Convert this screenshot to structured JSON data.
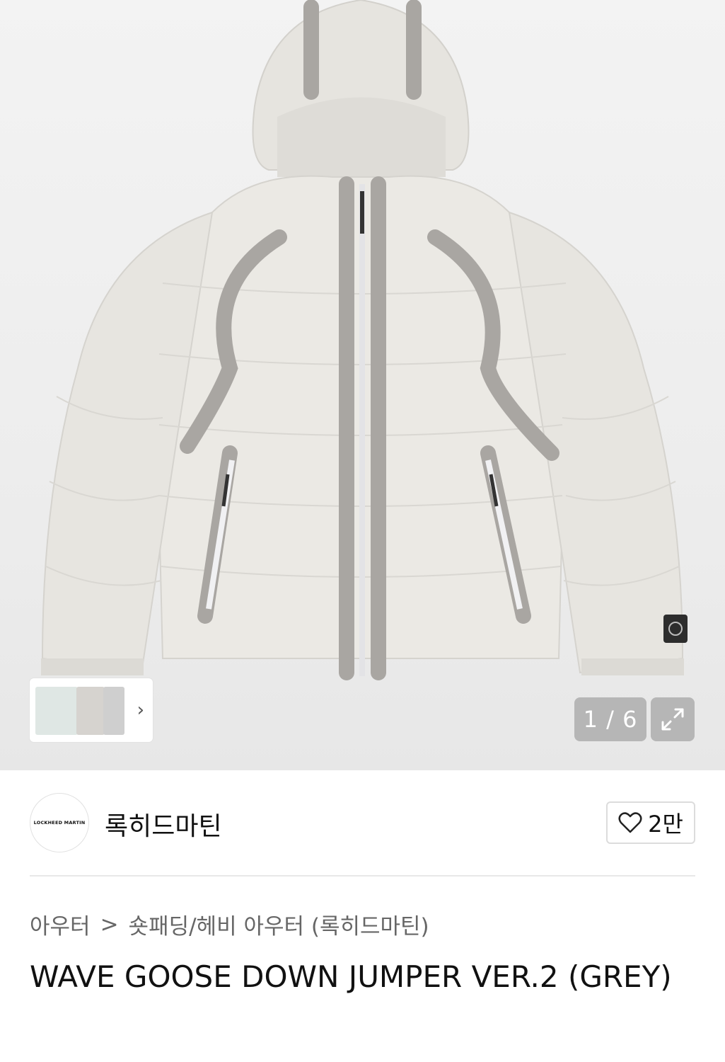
{
  "product_image": {
    "counter": "1 / 6",
    "thumbnail_icons": [
      "jacket-thumbnail",
      "jacket-thumbnail",
      "jacket-thumbnail"
    ],
    "next_icon": "chevron-right-icon",
    "expand_icon": "expand-icon"
  },
  "brand": {
    "logo_text": "LOCKHEED MARTIN",
    "name": "록히드마틴",
    "likes": "2만"
  },
  "breadcrumb": {
    "category": "아우터",
    "separator": ">",
    "subcategory": "숏패딩/헤비 아우터 (록히드마틴)"
  },
  "product": {
    "title": "WAVE GOOSE DOWN JUMPER VER.2 (GREY)"
  },
  "colors": {
    "jacket": "#e9e7e2",
    "trim": "#a9a6a2"
  }
}
